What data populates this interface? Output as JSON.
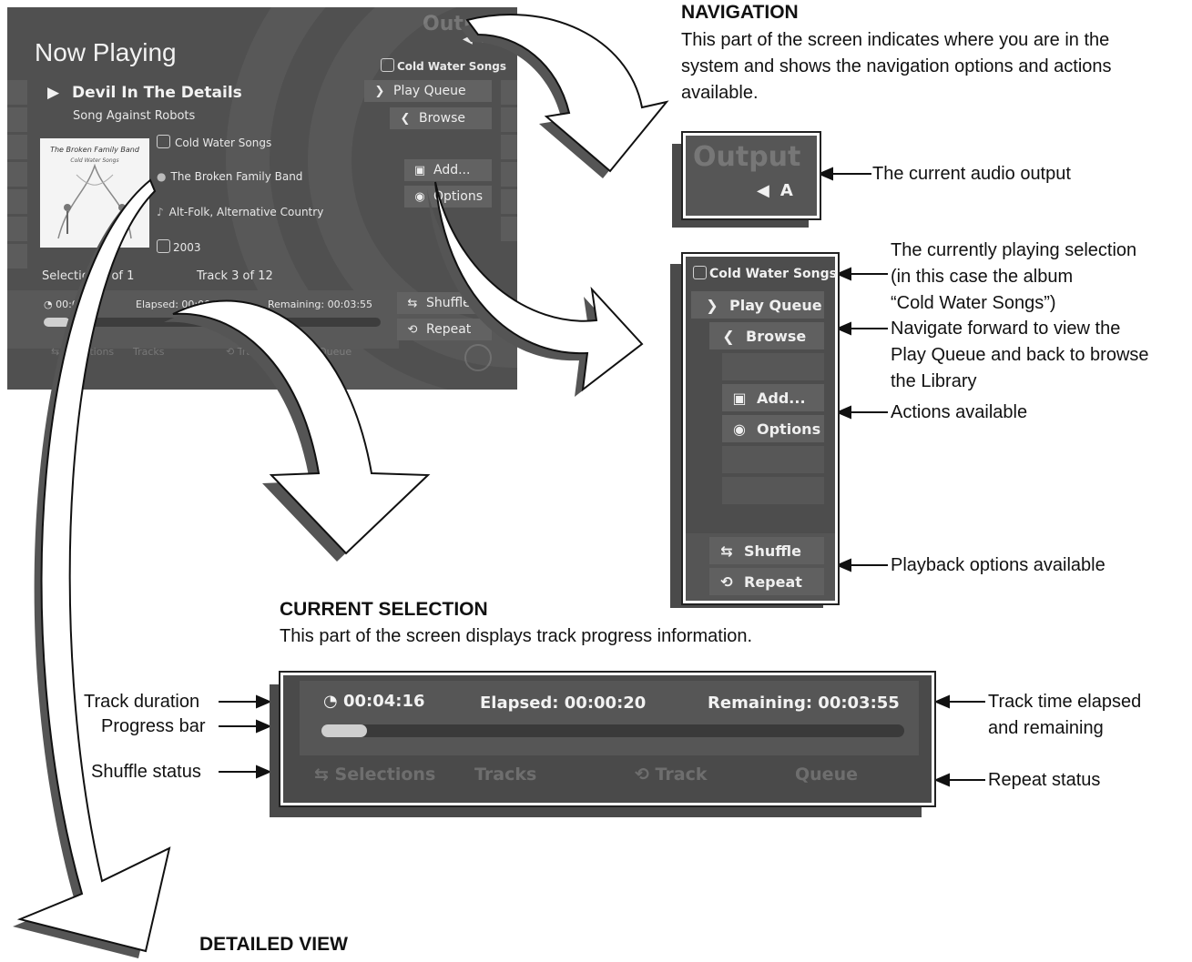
{
  "screen": {
    "output_ghost": "Output",
    "output_indicator": "A",
    "title": "Now Playing",
    "selection_label": "Cold Water Songs",
    "nav": {
      "play_queue": "Play Queue",
      "browse": "Browse",
      "add": "Add...",
      "options": "Options"
    },
    "track_title": "Devil In The Details",
    "track_subtitle": "Song Against Robots",
    "album": "Cold Water Songs",
    "artist": "The Broken Family Band",
    "genre": "Alt-Folk, Alternative Country",
    "year": "2003",
    "album_art_text": "The Broken Family Band",
    "album_art_subtext": "Cold Water Songs",
    "selection_count": "Selection 1 of 1",
    "track_count": "Track 3 of 12",
    "duration": "00:04:16",
    "elapsed": "Elapsed: 00:00:20",
    "remaining": "Remaining: 00:03:55",
    "shuffle": "Shuffle",
    "repeat": "Repeat",
    "status": {
      "selections": "Selections",
      "tracks": "Tracks",
      "track": "Track",
      "queue": "Queue"
    },
    "progress_fraction": 0.078
  },
  "navigation": {
    "heading": "NAVIGATION",
    "description": "This part of the screen indicates where you are in the system and shows the navigation options and actions available.",
    "output_label": "The current audio output",
    "callouts": {
      "current_selection": [
        "The currently playing selection",
        "(in this case the album",
        "“Cold Water Songs”)"
      ],
      "navigate": [
        "Navigate forward to view the",
        "Play Queue and back to browse",
        "the Library"
      ],
      "actions": "Actions available",
      "playback": "Playback options available"
    }
  },
  "current_selection": {
    "heading": "CURRENT SELECTION",
    "description": "This part of the screen displays track progress information.",
    "labels": {
      "track_duration": "Track duration",
      "progress_bar": "Progress bar",
      "shuffle_status": "Shuffle status",
      "elapsed_remaining": [
        "Track time elapsed",
        "and remaining"
      ],
      "repeat_status": "Repeat status"
    }
  },
  "detailed_view": {
    "heading": "DETAILED VIEW"
  },
  "colors": {
    "screen_bg": "#505050",
    "button_bg": "#626262",
    "text_light": "#ededed"
  }
}
